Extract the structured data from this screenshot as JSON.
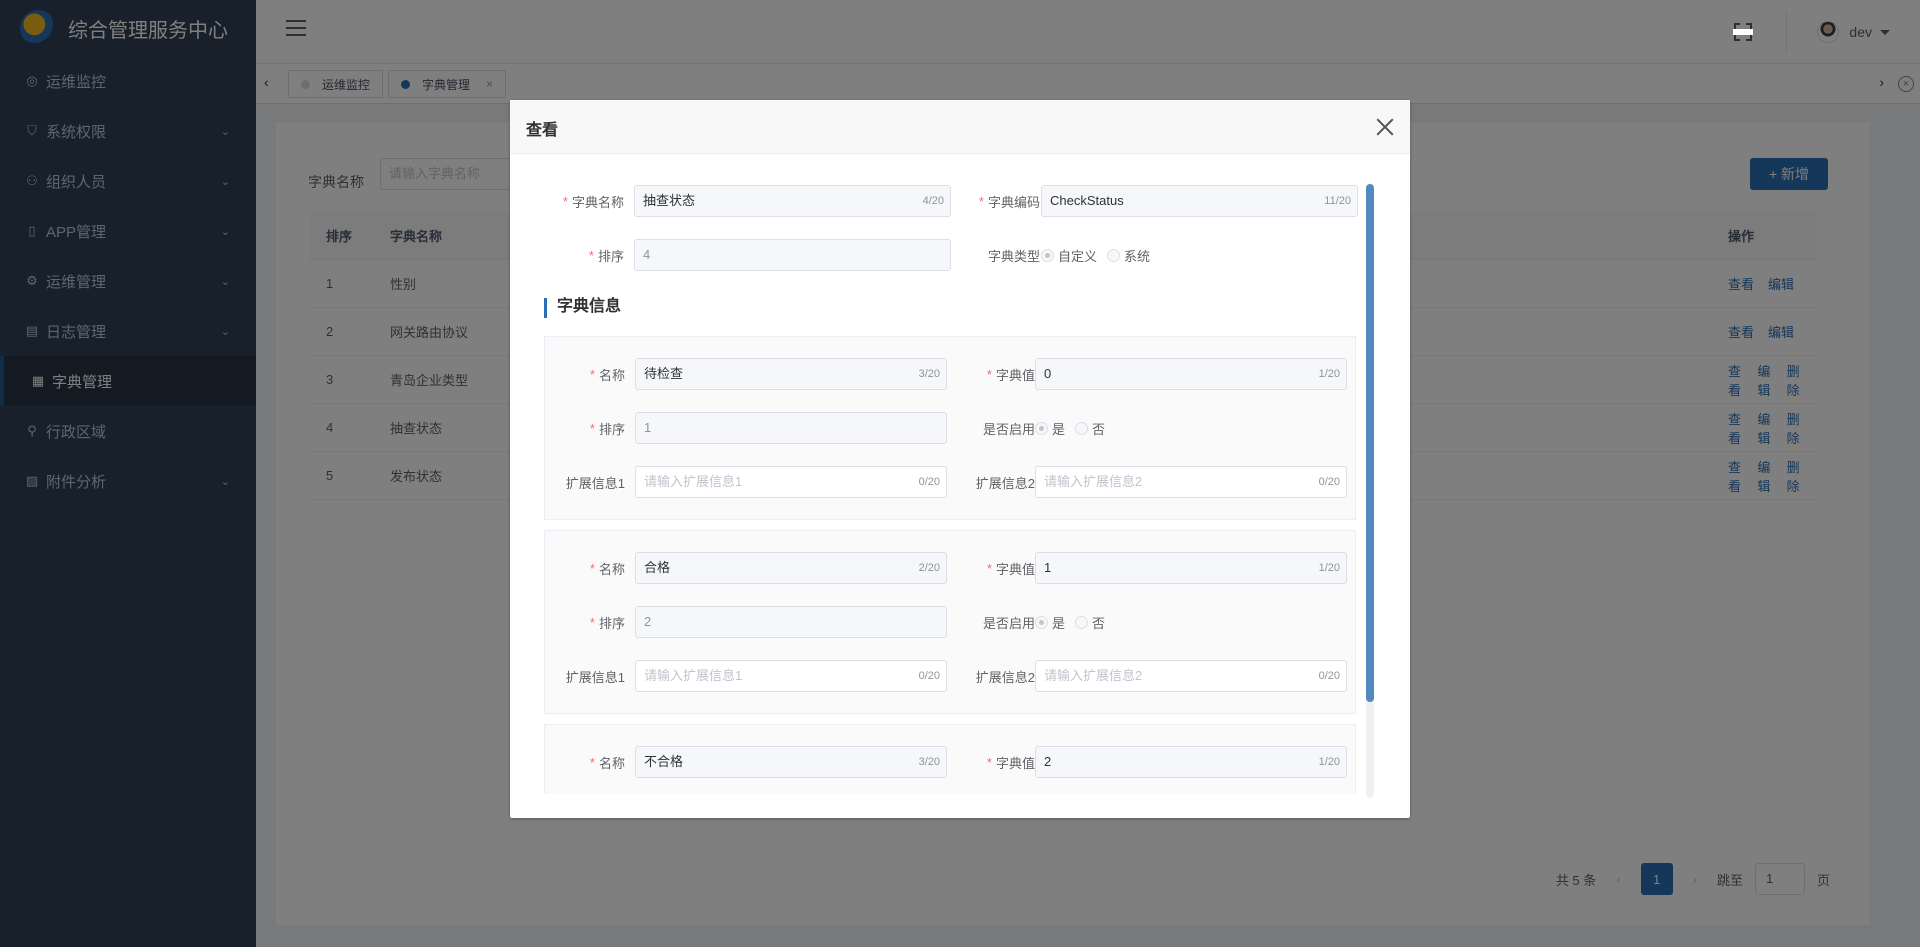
{
  "app": {
    "title": "综合管理服务中心",
    "user": "dev"
  },
  "sidebar": {
    "items": [
      {
        "label": "运维监控",
        "icon": "monitor-icon",
        "chevron": false,
        "active": false
      },
      {
        "label": "系统权限",
        "icon": "shield-icon",
        "chevron": true,
        "active": false
      },
      {
        "label": "组织人员",
        "icon": "user-icon",
        "chevron": true,
        "active": false
      },
      {
        "label": "APP管理",
        "icon": "phone-icon",
        "chevron": true,
        "active": false
      },
      {
        "label": "运维管理",
        "icon": "gear-icon",
        "chevron": true,
        "active": false
      },
      {
        "label": "日志管理",
        "icon": "log-icon",
        "chevron": true,
        "active": false
      },
      {
        "label": "字典管理",
        "icon": "dictionary-icon",
        "chevron": false,
        "active": true
      },
      {
        "label": "行政区域",
        "icon": "region-icon",
        "chevron": false,
        "active": false
      },
      {
        "label": "附件分析",
        "icon": "attachment-icon",
        "chevron": true,
        "active": false
      }
    ]
  },
  "tabs": [
    {
      "label": "运维监控",
      "active": false
    },
    {
      "label": "字典管理",
      "active": true,
      "close": "×"
    }
  ],
  "filter": {
    "label": "字典名称",
    "placeholder": "请输入字典名称"
  },
  "toolbar": {
    "add_label": "+ 新增"
  },
  "table": {
    "headers": {
      "index": "排序",
      "name": "字典名称",
      "ops": "操作"
    },
    "rows": [
      {
        "index": "1",
        "name": "性别",
        "ops": [
          "查看",
          "编辑"
        ]
      },
      {
        "index": "2",
        "name": "网关路由协议",
        "ops": [
          "查看",
          "编辑"
        ]
      },
      {
        "index": "3",
        "name": "青岛企业类型",
        "ops": [
          "查看",
          "编辑",
          "删除"
        ]
      },
      {
        "index": "4",
        "name": "抽查状态",
        "ops": [
          "查看",
          "编辑",
          "删除"
        ]
      },
      {
        "index": "5",
        "name": "发布状态",
        "ops": [
          "查看",
          "编辑",
          "删除"
        ]
      }
    ]
  },
  "pagination": {
    "total": "共 5 条",
    "prev": "‹",
    "current": "1",
    "next": "›",
    "jump_label": "跳至",
    "jump_value": "1",
    "page_suffix": "页"
  },
  "dialog": {
    "title": "查看",
    "dict_name_label": "字典名称",
    "dict_name_value": "抽查状态",
    "dict_name_count": "4/20",
    "dict_code_label": "字典编码",
    "dict_code_value": "CheckStatus",
    "dict_code_count": "11/20",
    "sort_label": "排序",
    "sort_value": "4",
    "type_label": "字典类型",
    "type_options": [
      "自定义",
      "系统"
    ],
    "section_title": "字典信息",
    "labels": {
      "name": "名称",
      "value": "字典值",
      "sort": "排序",
      "enabled": "是否启用",
      "yes": "是",
      "no": "否",
      "ext1": "扩展信息1",
      "ext2": "扩展信息2",
      "ext1_placeholder": "请输入扩展信息1",
      "ext2_placeholder": "请输入扩展信息2",
      "ext_count": "0/20"
    },
    "items": [
      {
        "name": "待检查",
        "name_count": "3/20",
        "value": "0",
        "value_count": "1/20",
        "sort": "1"
      },
      {
        "name": "合格",
        "name_count": "2/20",
        "value": "1",
        "value_count": "1/20",
        "sort": "2"
      },
      {
        "name": "不合格",
        "name_count": "3/20",
        "value": "2",
        "value_count": "1/20"
      }
    ]
  }
}
